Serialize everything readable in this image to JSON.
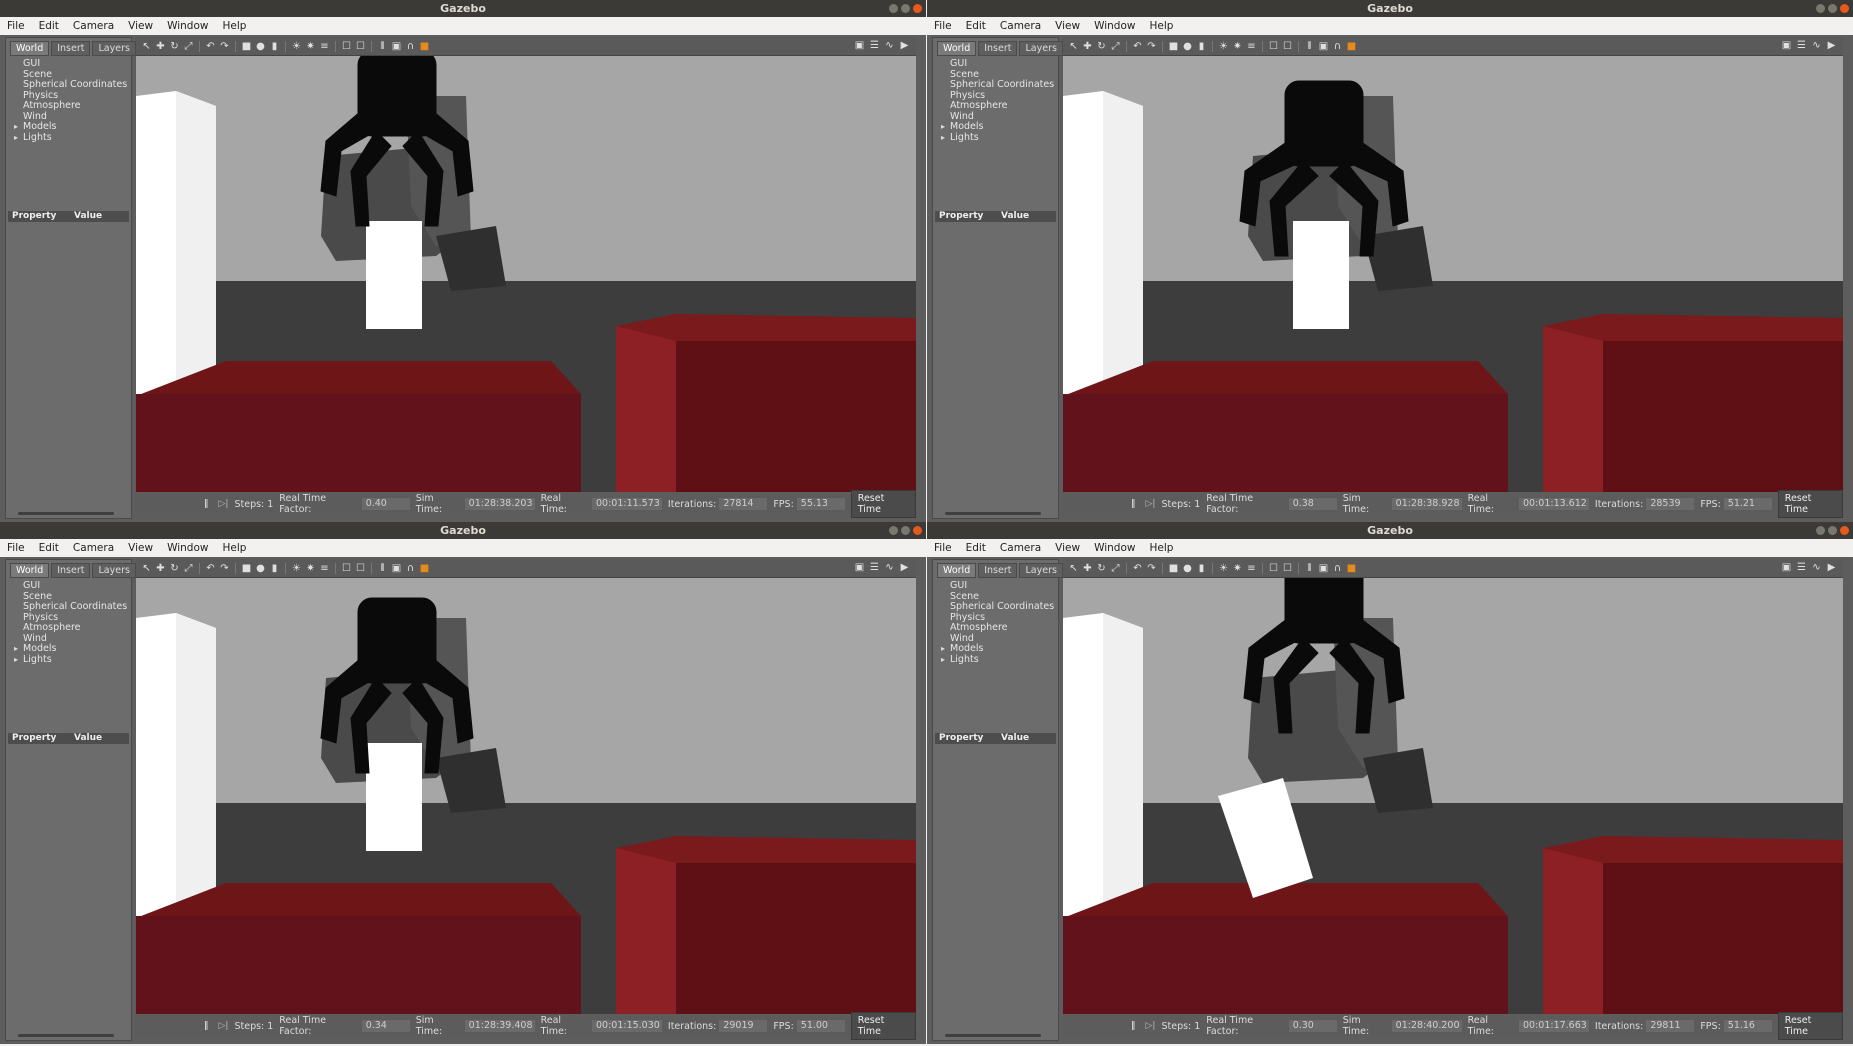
{
  "menu": [
    "File",
    "Edit",
    "Camera",
    "View",
    "Window",
    "Help"
  ],
  "panel_tabs": [
    "World",
    "Insert",
    "Layers"
  ],
  "tree_items": [
    {
      "label": "GUI",
      "expandable": false
    },
    {
      "label": "Scene",
      "expandable": false
    },
    {
      "label": "Spherical Coordinates",
      "expandable": false
    },
    {
      "label": "Physics",
      "expandable": false
    },
    {
      "label": "Atmosphere",
      "expandable": false
    },
    {
      "label": "Wind",
      "expandable": false
    },
    {
      "label": "Models",
      "expandable": true
    },
    {
      "label": "Lights",
      "expandable": true
    }
  ],
  "property_header": {
    "property": "Property",
    "value": "Value"
  },
  "status_labels": {
    "steps": "Steps:",
    "rtf": "Real Time Factor:",
    "sim_time": "Sim Time:",
    "real_time": "Real Time:",
    "iterations": "Iterations:",
    "fps": "FPS:",
    "reset": "Reset Time"
  },
  "colors": {
    "table_red": "#6e1518",
    "block_white": "#ffffff",
    "gripper": "#0a0a0a",
    "floor": "#3a3a3a",
    "wall": "#a6a6a6",
    "orange_tool": "#e88a1b"
  },
  "windows": [
    {
      "title": "Gazebo",
      "steps": "1",
      "rtf": "0.40",
      "sim_time": "01:28:38.203",
      "real_time": "00:01:11.573",
      "iterations": "27814",
      "fps": "55.13"
    },
    {
      "title": "Gazebo",
      "steps": "1",
      "rtf": "0.38",
      "sim_time": "01:28:38.928",
      "real_time": "00:01:13.612",
      "iterations": "28539",
      "fps": "51.21"
    },
    {
      "title": "Gazebo",
      "steps": "1",
      "rtf": "0.34",
      "sim_time": "01:28:39.408",
      "real_time": "00:01:15.030",
      "iterations": "29019",
      "fps": "51.00"
    },
    {
      "title": "Gazebo",
      "steps": "1",
      "rtf": "0.30",
      "sim_time": "01:28:40.200",
      "real_time": "00:01:17.663",
      "iterations": "29811",
      "fps": "51.16"
    }
  ]
}
